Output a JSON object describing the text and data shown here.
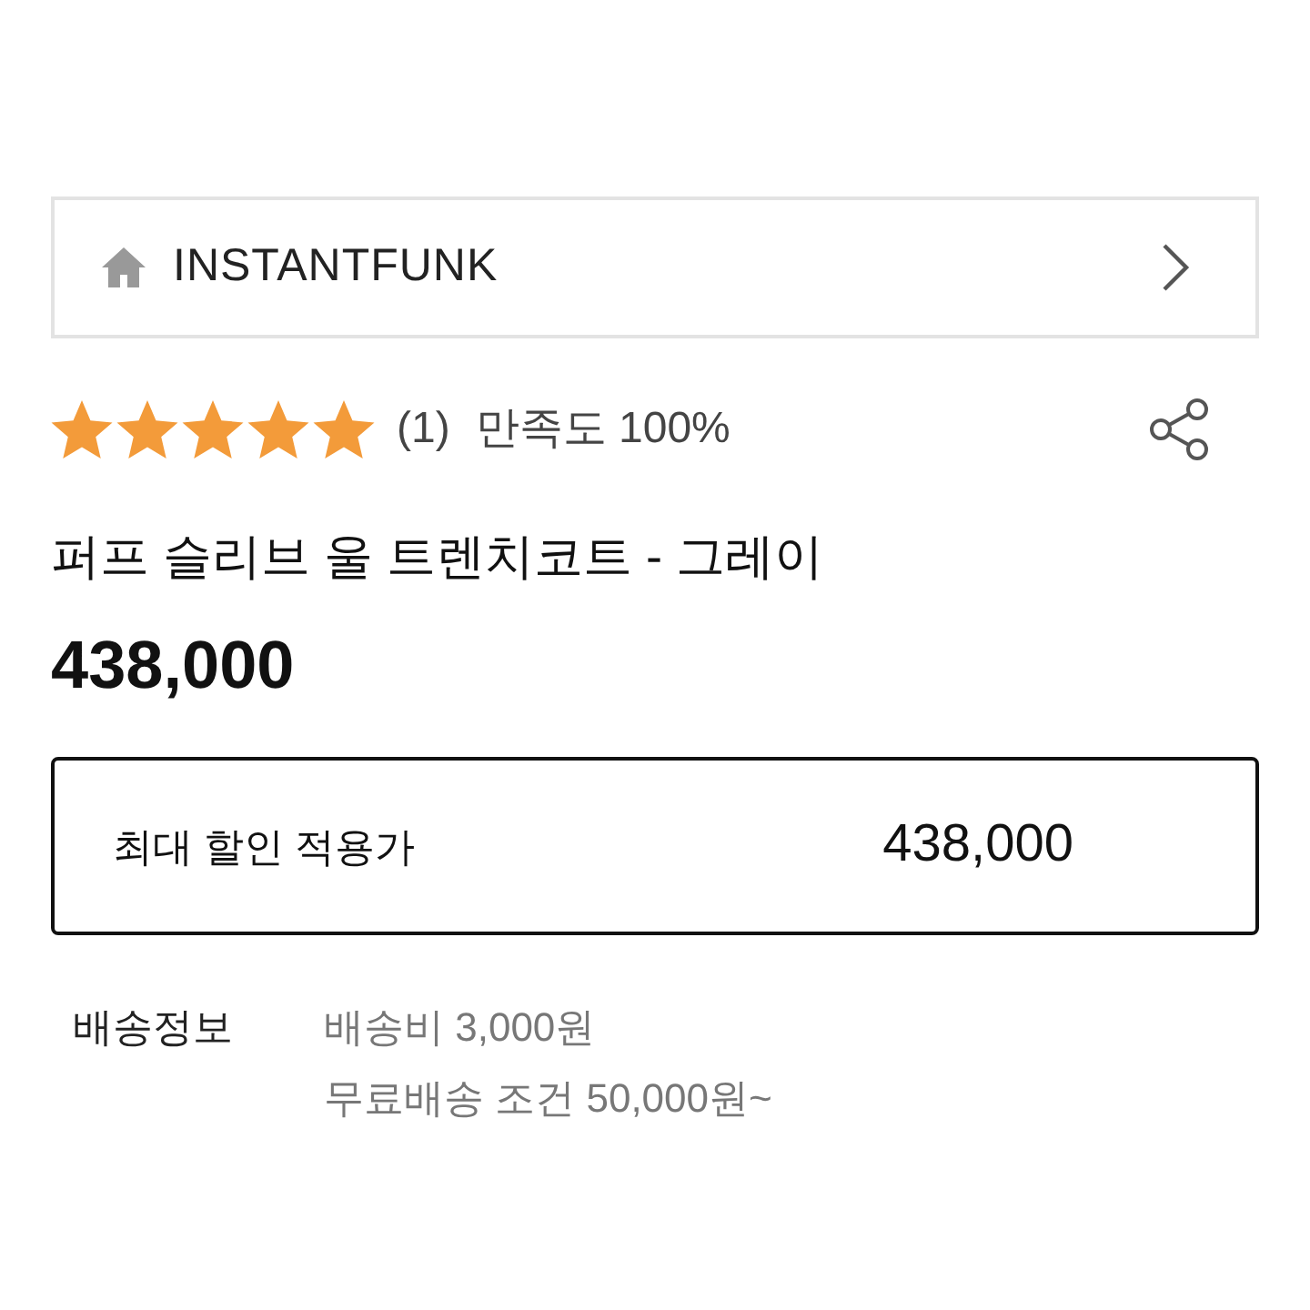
{
  "brand_bar": {
    "name": "INSTANTFUNK"
  },
  "rating": {
    "stars": 5,
    "review_count": "(1)",
    "satisfaction": "만족도 100%"
  },
  "product": {
    "title": "퍼프 슬리브 울 트렌치코트 - 그레이",
    "price": "438,000"
  },
  "max_discount": {
    "label": "최대 할인 적용가",
    "price": "438,000"
  },
  "shipping": {
    "label": "배송정보",
    "lines": [
      "배송비 3,000원",
      "무료배송 조건 50,000원~"
    ]
  }
}
